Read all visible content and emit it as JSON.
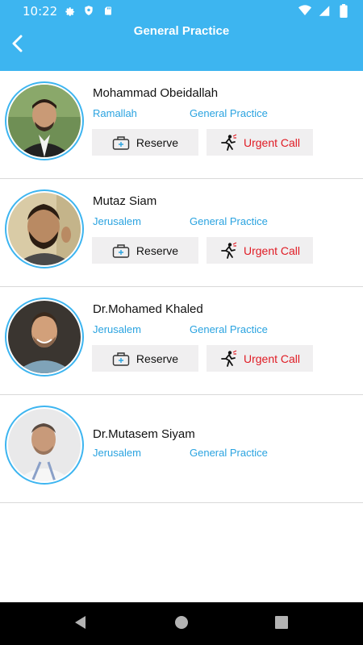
{
  "status_bar": {
    "time": "10:22",
    "left_icons": [
      "gear-icon",
      "shield-icon",
      "sd-card-icon"
    ],
    "right_icons": [
      "wifi-icon",
      "signal-icon",
      "battery-icon"
    ]
  },
  "app_bar": {
    "title": "General Practice",
    "back_icon": "arrow-back-icon"
  },
  "doctors": [
    {
      "name": "Mohammad Obeidallah",
      "city": "Ramallah",
      "specialty": "General Practice",
      "reserve_label": "Reserve",
      "urgent_label": "Urgent Call",
      "show_actions": true
    },
    {
      "name": "Mutaz Siam",
      "city": "Jerusalem",
      "specialty": "General Practice",
      "reserve_label": "Reserve",
      "urgent_label": "Urgent Call",
      "show_actions": true
    },
    {
      "name": "Dr.Mohamed Khaled",
      "city": "Jerusalem",
      "specialty": "General Practice",
      "reserve_label": "Reserve",
      "urgent_label": "Urgent Call",
      "show_actions": true
    },
    {
      "name": "Dr.Mutasem Siyam",
      "city": "Jerusalem",
      "specialty": "General Practice",
      "show_actions": false
    }
  ],
  "colors": {
    "primary": "#3db5f0",
    "link_text": "#2aa3e0",
    "urgent": "#e01b24",
    "button_bg": "#f0eff0",
    "nav_bg": "#000000"
  },
  "nav_bar": [
    "back-triangle-icon",
    "home-circle-icon",
    "recents-square-icon"
  ]
}
